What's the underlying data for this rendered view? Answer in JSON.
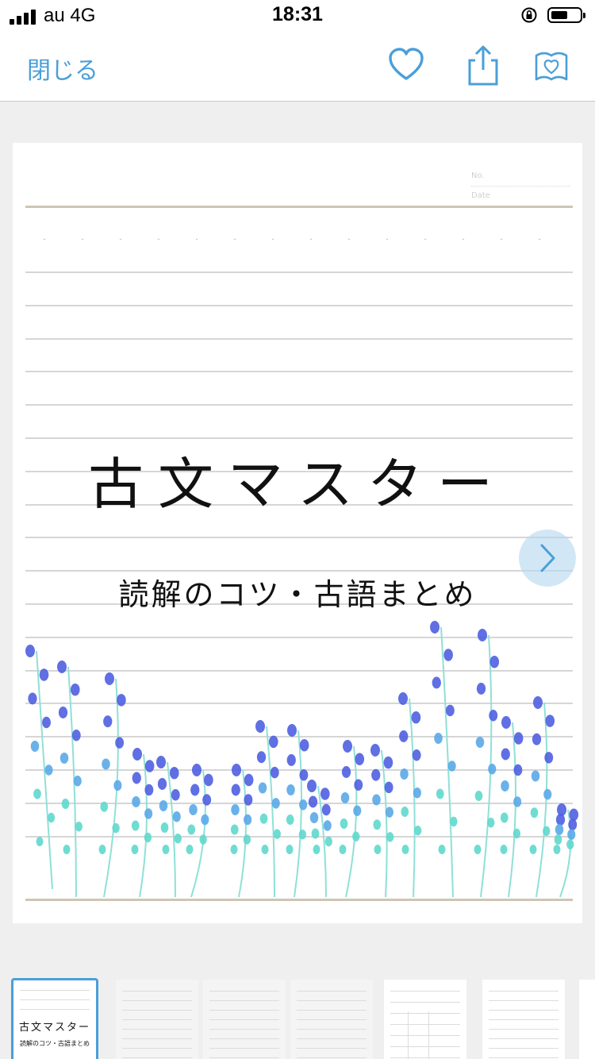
{
  "status_bar": {
    "carrier": "au 4G",
    "time": "18:31",
    "battery_level": 0.6
  },
  "toolbar": {
    "close_label": "閉じる"
  },
  "icons": {
    "favorite": "heart-icon",
    "share": "share-icon",
    "collection": "folder-heart-icon",
    "next": "chevron-right-icon"
  },
  "note": {
    "header_labels": [
      "No.",
      "Date"
    ],
    "title": "古文マスター",
    "subtitle": "読解のコツ・古語まとめ"
  },
  "thumbnail_title": "古文マスター",
  "thumbnail_subtitle": "読解のコツ・古語まとめ",
  "thumbnail_count": 7,
  "selected_thumbnail": 1,
  "colors": {
    "accent": "#4a9fd8",
    "background": "#efefef",
    "flower_blue": "#4f5fe0",
    "flower_teal": "#5fd8cc"
  }
}
